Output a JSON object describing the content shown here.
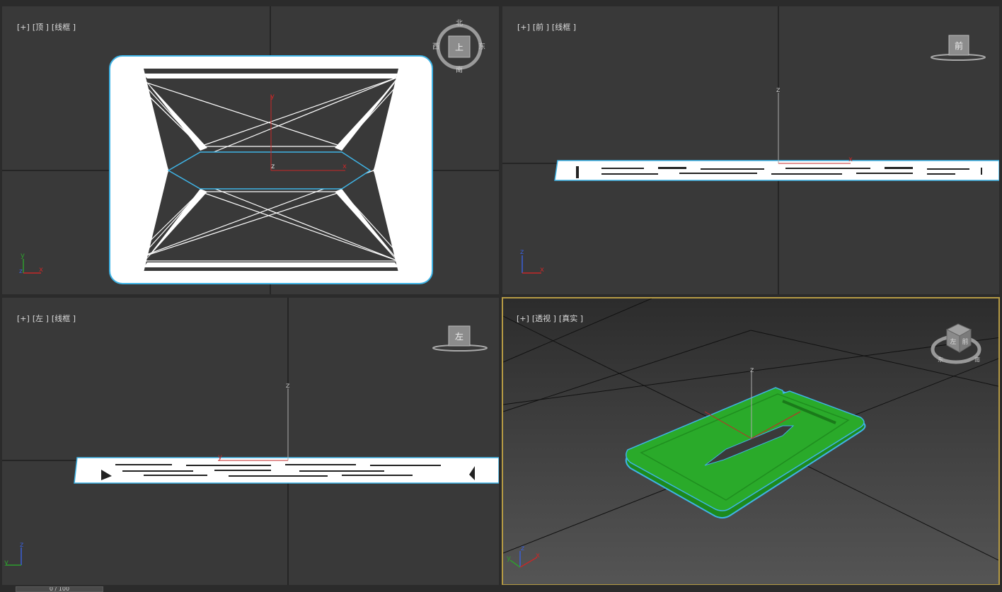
{
  "viewports": {
    "top": {
      "plus": "[+]",
      "view": "[顶 ]",
      "shading": "[线框 ]",
      "compass": {
        "n": "北",
        "s": "南",
        "e": "东",
        "w": "西",
        "cube": "上"
      },
      "gizmo": {
        "x": "x",
        "y": "y",
        "z": "z"
      }
    },
    "front": {
      "plus": "[+]",
      "view": "[前 ]",
      "shading": "[线框 ]",
      "cube": "前",
      "gizmo": {
        "x": "x",
        "z": "z"
      }
    },
    "left": {
      "plus": "[+]",
      "view": "[左 ]",
      "shading": "[线框 ]",
      "cube": "左",
      "gizmo": {
        "y": "y",
        "z": "z"
      }
    },
    "persp": {
      "plus": "[+]",
      "view": "[透视 ]",
      "shading": "[真实 ]",
      "cube": {
        "left": "左",
        "front": "前",
        "ring_left": "东",
        "ring_right": "南"
      },
      "gizmo": {
        "x": "x",
        "y": "y",
        "z": "z"
      }
    }
  },
  "colors": {
    "viewport_bg": "#393939",
    "active_border": "#b59a44",
    "object_fill": "#2aaa2a",
    "selection_outline": "#3fb4e6",
    "wire": "#ffffff",
    "axis_x": "#c62828",
    "axis_y": "#2e9e2e",
    "axis_z": "#3a5fd6"
  },
  "status": {
    "time_slider": "0 / 100"
  }
}
